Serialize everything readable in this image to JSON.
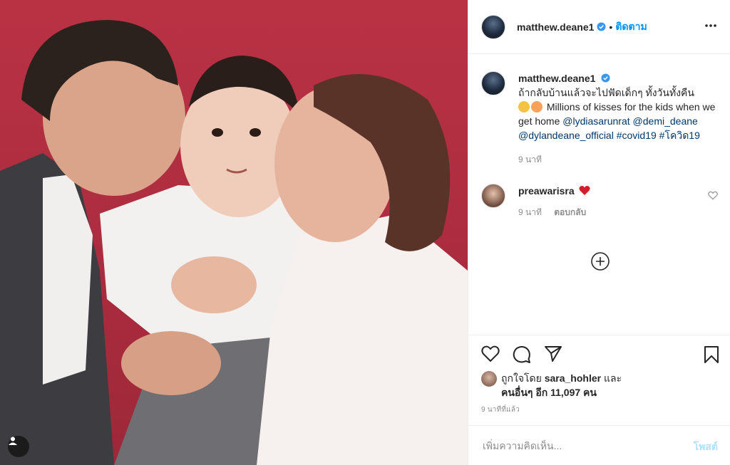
{
  "post": {
    "author": "matthew.deane1",
    "dot": "•",
    "follow_label": "ติดตาม",
    "caption": {
      "text_thai": "ถ้ากลับบ้านแล้วจะไปฟัดเด็กๆ ทั้งวันทั้งคืน",
      "text_en": "Millions of kisses for the kids when we get home",
      "mention_1": "@lydiasarunrat",
      "mention_2": "@demi_deane",
      "mention_3": "@dylandeane_official",
      "hashtag_1": "#covid19",
      "hashtag_2": "#โควิด19",
      "time": "9 นาที"
    },
    "comment": {
      "user": "preawarisra",
      "time": "9 นาที",
      "reply_label": "ตอบกลับ"
    },
    "likes": {
      "prefix": "ถูกใจโดย",
      "user": "sara_hohler",
      "and": "และ",
      "others": "คนอื่นๆ อีก 11,097 คน"
    },
    "time_ago": "9 นาทีที่แล้ว",
    "add_comment_placeholder": "เพิ่มความคิดเห็น...",
    "post_button_label": "โพสต์"
  },
  "colors": {
    "accent": "#0095f6",
    "background_red": "#b02e41",
    "heart_red": "#ed4956",
    "muted": "#8e8e8e"
  },
  "icons": [
    "more-icon",
    "verified-icon",
    "heart-icon",
    "comment-icon",
    "share-icon",
    "bookmark-icon",
    "plus-circle-icon",
    "user-tag-icon"
  ]
}
